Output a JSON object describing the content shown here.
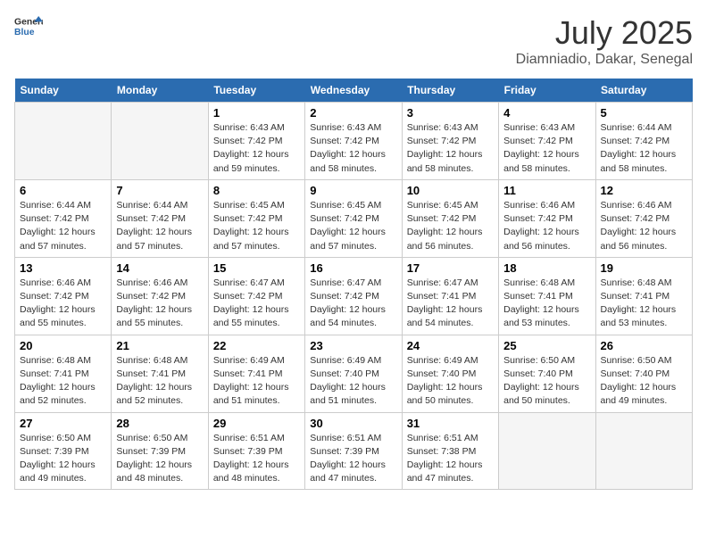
{
  "logo": {
    "line1": "General",
    "line2": "Blue"
  },
  "title": "July 2025",
  "subtitle": "Diamniadio, Dakar, Senegal",
  "weekdays": [
    "Sunday",
    "Monday",
    "Tuesday",
    "Wednesday",
    "Thursday",
    "Friday",
    "Saturday"
  ],
  "weeks": [
    [
      {
        "day": "",
        "info": ""
      },
      {
        "day": "",
        "info": ""
      },
      {
        "day": "1",
        "info": "Sunrise: 6:43 AM\nSunset: 7:42 PM\nDaylight: 12 hours and 59 minutes."
      },
      {
        "day": "2",
        "info": "Sunrise: 6:43 AM\nSunset: 7:42 PM\nDaylight: 12 hours and 58 minutes."
      },
      {
        "day": "3",
        "info": "Sunrise: 6:43 AM\nSunset: 7:42 PM\nDaylight: 12 hours and 58 minutes."
      },
      {
        "day": "4",
        "info": "Sunrise: 6:43 AM\nSunset: 7:42 PM\nDaylight: 12 hours and 58 minutes."
      },
      {
        "day": "5",
        "info": "Sunrise: 6:44 AM\nSunset: 7:42 PM\nDaylight: 12 hours and 58 minutes."
      }
    ],
    [
      {
        "day": "6",
        "info": "Sunrise: 6:44 AM\nSunset: 7:42 PM\nDaylight: 12 hours and 57 minutes."
      },
      {
        "day": "7",
        "info": "Sunrise: 6:44 AM\nSunset: 7:42 PM\nDaylight: 12 hours and 57 minutes."
      },
      {
        "day": "8",
        "info": "Sunrise: 6:45 AM\nSunset: 7:42 PM\nDaylight: 12 hours and 57 minutes."
      },
      {
        "day": "9",
        "info": "Sunrise: 6:45 AM\nSunset: 7:42 PM\nDaylight: 12 hours and 57 minutes."
      },
      {
        "day": "10",
        "info": "Sunrise: 6:45 AM\nSunset: 7:42 PM\nDaylight: 12 hours and 56 minutes."
      },
      {
        "day": "11",
        "info": "Sunrise: 6:46 AM\nSunset: 7:42 PM\nDaylight: 12 hours and 56 minutes."
      },
      {
        "day": "12",
        "info": "Sunrise: 6:46 AM\nSunset: 7:42 PM\nDaylight: 12 hours and 56 minutes."
      }
    ],
    [
      {
        "day": "13",
        "info": "Sunrise: 6:46 AM\nSunset: 7:42 PM\nDaylight: 12 hours and 55 minutes."
      },
      {
        "day": "14",
        "info": "Sunrise: 6:46 AM\nSunset: 7:42 PM\nDaylight: 12 hours and 55 minutes."
      },
      {
        "day": "15",
        "info": "Sunrise: 6:47 AM\nSunset: 7:42 PM\nDaylight: 12 hours and 55 minutes."
      },
      {
        "day": "16",
        "info": "Sunrise: 6:47 AM\nSunset: 7:42 PM\nDaylight: 12 hours and 54 minutes."
      },
      {
        "day": "17",
        "info": "Sunrise: 6:47 AM\nSunset: 7:41 PM\nDaylight: 12 hours and 54 minutes."
      },
      {
        "day": "18",
        "info": "Sunrise: 6:48 AM\nSunset: 7:41 PM\nDaylight: 12 hours and 53 minutes."
      },
      {
        "day": "19",
        "info": "Sunrise: 6:48 AM\nSunset: 7:41 PM\nDaylight: 12 hours and 53 minutes."
      }
    ],
    [
      {
        "day": "20",
        "info": "Sunrise: 6:48 AM\nSunset: 7:41 PM\nDaylight: 12 hours and 52 minutes."
      },
      {
        "day": "21",
        "info": "Sunrise: 6:48 AM\nSunset: 7:41 PM\nDaylight: 12 hours and 52 minutes."
      },
      {
        "day": "22",
        "info": "Sunrise: 6:49 AM\nSunset: 7:41 PM\nDaylight: 12 hours and 51 minutes."
      },
      {
        "day": "23",
        "info": "Sunrise: 6:49 AM\nSunset: 7:40 PM\nDaylight: 12 hours and 51 minutes."
      },
      {
        "day": "24",
        "info": "Sunrise: 6:49 AM\nSunset: 7:40 PM\nDaylight: 12 hours and 50 minutes."
      },
      {
        "day": "25",
        "info": "Sunrise: 6:50 AM\nSunset: 7:40 PM\nDaylight: 12 hours and 50 minutes."
      },
      {
        "day": "26",
        "info": "Sunrise: 6:50 AM\nSunset: 7:40 PM\nDaylight: 12 hours and 49 minutes."
      }
    ],
    [
      {
        "day": "27",
        "info": "Sunrise: 6:50 AM\nSunset: 7:39 PM\nDaylight: 12 hours and 49 minutes."
      },
      {
        "day": "28",
        "info": "Sunrise: 6:50 AM\nSunset: 7:39 PM\nDaylight: 12 hours and 48 minutes."
      },
      {
        "day": "29",
        "info": "Sunrise: 6:51 AM\nSunset: 7:39 PM\nDaylight: 12 hours and 48 minutes."
      },
      {
        "day": "30",
        "info": "Sunrise: 6:51 AM\nSunset: 7:39 PM\nDaylight: 12 hours and 47 minutes."
      },
      {
        "day": "31",
        "info": "Sunrise: 6:51 AM\nSunset: 7:38 PM\nDaylight: 12 hours and 47 minutes."
      },
      {
        "day": "",
        "info": ""
      },
      {
        "day": "",
        "info": ""
      }
    ]
  ]
}
